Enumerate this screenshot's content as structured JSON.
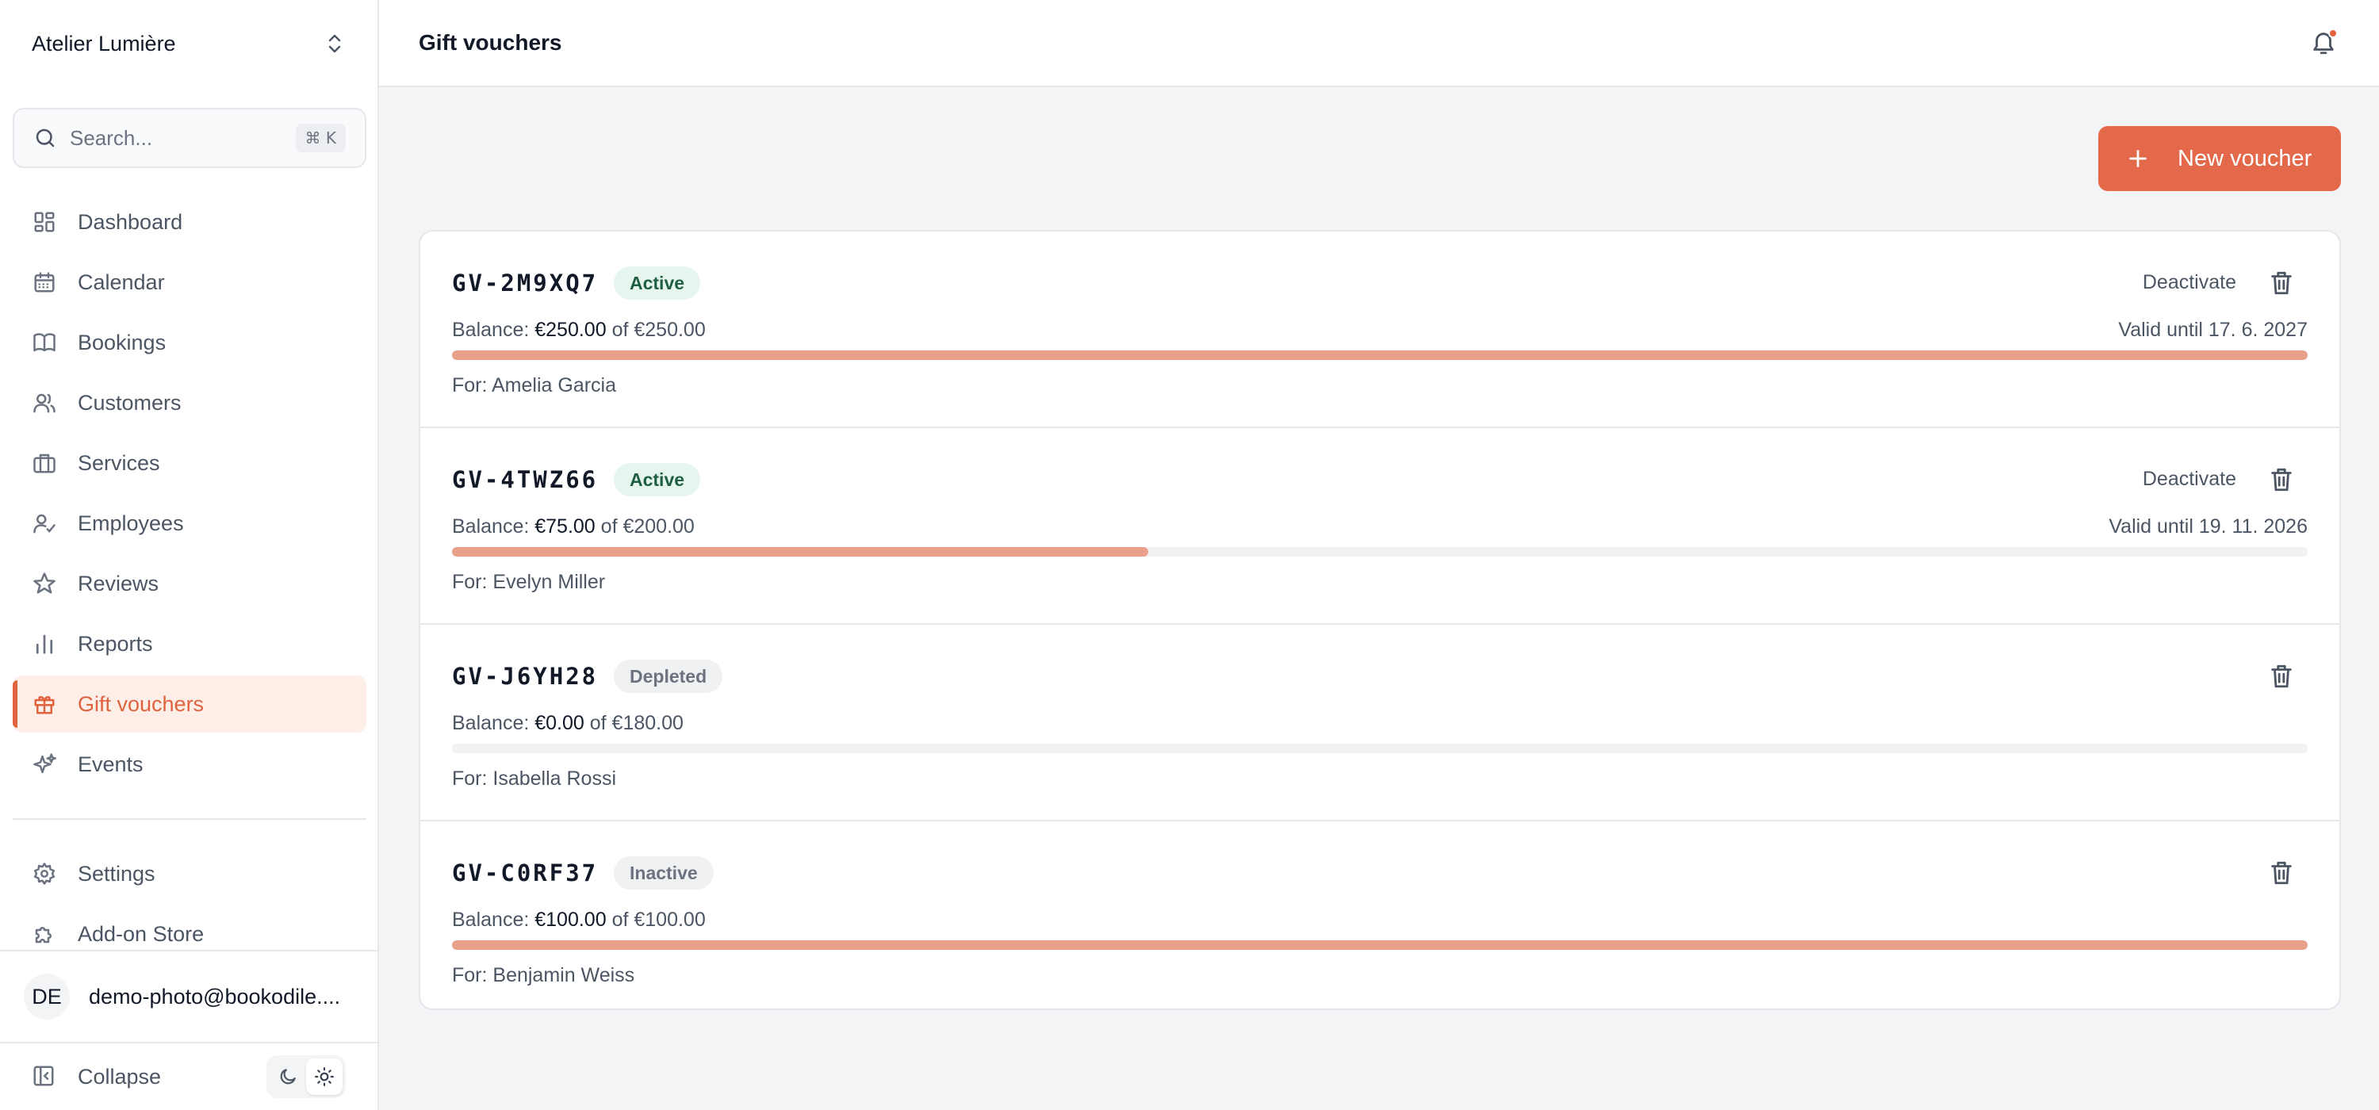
{
  "workspace": {
    "name": "Atelier Lumière"
  },
  "search": {
    "placeholder": "Search...",
    "shortcut": "⌘ K"
  },
  "nav": {
    "items": [
      {
        "label": "Dashboard",
        "icon": "dashboard-icon"
      },
      {
        "label": "Calendar",
        "icon": "calendar-icon"
      },
      {
        "label": "Bookings",
        "icon": "book-icon"
      },
      {
        "label": "Customers",
        "icon": "users-icon"
      },
      {
        "label": "Services",
        "icon": "briefcase-icon"
      },
      {
        "label": "Employees",
        "icon": "user-check-icon"
      },
      {
        "label": "Reviews",
        "icon": "star-icon"
      },
      {
        "label": "Reports",
        "icon": "bar-chart-icon"
      },
      {
        "label": "Gift vouchers",
        "icon": "gift-icon",
        "active": true
      },
      {
        "label": "Events",
        "icon": "sparkles-icon"
      }
    ],
    "secondary": [
      {
        "label": "Settings",
        "icon": "gear-icon"
      },
      {
        "label": "Add-on Store",
        "icon": "puzzle-icon"
      }
    ]
  },
  "user": {
    "initials": "DE",
    "email": "demo-photo@bookodile...."
  },
  "footer": {
    "collapse_label": "Collapse"
  },
  "header": {
    "title": "Gift vouchers"
  },
  "actions": {
    "new_voucher": "New voucher"
  },
  "colors": {
    "accent": "#e3694a",
    "active_badge_bg": "#e6f6ee",
    "progress_fill": "#e9a08a"
  },
  "vouchers": [
    {
      "code": "GV-2M9XQ7",
      "status": "Active",
      "balance_label": "Balance:",
      "balance": "€250.00",
      "of_total": "of €250.00",
      "valid_until": "Valid until 17. 6. 2027",
      "for": "For: Amelia Garcia",
      "action": "Deactivate",
      "remaining_fraction": 1.0
    },
    {
      "code": "GV-4TWZ66",
      "status": "Active",
      "balance_label": "Balance:",
      "balance": "€75.00",
      "of_total": "of €200.00",
      "valid_until": "Valid until 19. 11. 2026",
      "for": "For: Evelyn Miller",
      "action": "Deactivate",
      "remaining_fraction": 0.375
    },
    {
      "code": "GV-J6YH28",
      "status": "Depleted",
      "balance_label": "Balance:",
      "balance": "€0.00",
      "of_total": "of €180.00",
      "valid_until": "",
      "for": "For: Isabella Rossi",
      "action": "",
      "remaining_fraction": 0.0
    },
    {
      "code": "GV-C0RF37",
      "status": "Inactive",
      "balance_label": "Balance:",
      "balance": "€100.00",
      "of_total": "of €100.00",
      "valid_until": "",
      "for": "For: Benjamin Weiss",
      "action": "",
      "remaining_fraction": 1.0
    }
  ]
}
